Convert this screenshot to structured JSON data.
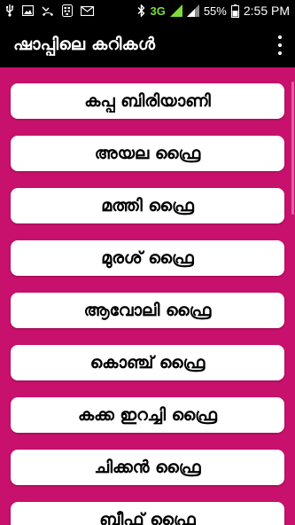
{
  "status_bar": {
    "network": "3G",
    "battery_percent": "55%",
    "time": "2:55 PM",
    "icons_left": [
      "usb-icon",
      "image-icon",
      "missed-call-icon",
      "bbm-icon",
      "email-icon"
    ],
    "icons_right": [
      "bluetooth-icon",
      "signal-icon",
      "signal-icon",
      "battery-icon"
    ]
  },
  "app_bar": {
    "title": "ഷാപ്പിലെ കറികൾ"
  },
  "colors": {
    "background": "#c8106d",
    "app_bar": "#000000",
    "button": "#ffffff",
    "net_3g": "#7ddc3a"
  },
  "curries": [
    {
      "label": "കപ്പ ബിരിയാണി"
    },
    {
      "label": "അയല ഫ്രൈ"
    },
    {
      "label": "മത്തി ഫ്രൈ"
    },
    {
      "label": "മുരശ് ഫ്രൈ"
    },
    {
      "label": "ആവോലി ഫ്രൈ"
    },
    {
      "label": "കൊഞ്ച് ഫ്രൈ"
    },
    {
      "label": "കക്ക ഇറച്ചി ഫ്രൈ"
    },
    {
      "label": "ചിക്കൻ ഫ്രൈ"
    },
    {
      "label": "ബീഫ് ഫ്രൈ"
    }
  ]
}
